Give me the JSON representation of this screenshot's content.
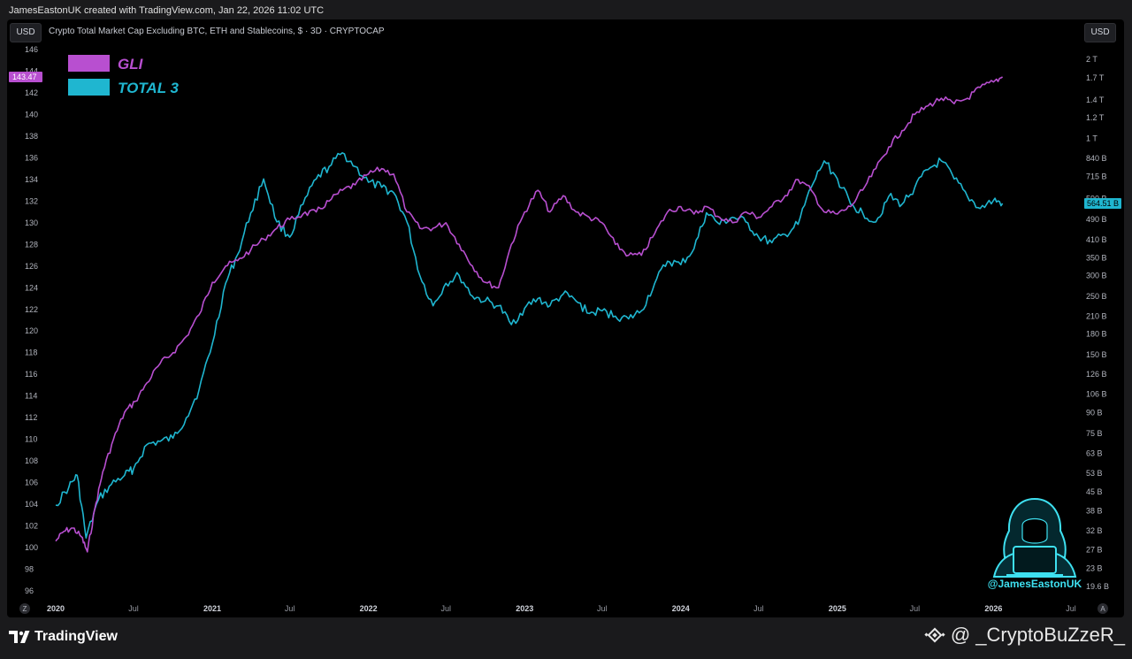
{
  "header": {
    "caption": "JamesEastonUK created with TradingView.com, Jan 22, 2026 11:02 UTC"
  },
  "toolbar": {
    "currency_left": "USD",
    "currency_right": "USD"
  },
  "symbol": {
    "title": "Crypto Total Market Cap Excluding BTC, ETH and Stablecoins, $ · 3D · CRYPTOCAP"
  },
  "footer": {
    "brand": "TradingView",
    "watermark": "@ _CryptoBuZzeR_",
    "handle": "@JamesEastonUK"
  },
  "buttons": {
    "z": "Z",
    "a": "A"
  },
  "colors": {
    "gli": "#b84fd0",
    "total3": "#1fb6d0",
    "background": "#000000"
  },
  "chart_data": {
    "type": "line",
    "legend": [
      {
        "name": "GLI",
        "color": "#b84fd0"
      },
      {
        "name": "TOTAL 3",
        "color": "#1fb6d0"
      }
    ],
    "legend_position": "top-left",
    "grid": false,
    "x_ticks": [
      "2020",
      "Jul",
      "2021",
      "Jul",
      "2022",
      "Jul",
      "2023",
      "Jul",
      "2024",
      "Jul",
      "2025",
      "Jul",
      "2026",
      "Jul"
    ],
    "x_range": [
      "2020-01",
      "2026-07"
    ],
    "y_left": {
      "ticks": [
        96,
        98,
        100,
        102,
        104,
        106,
        108,
        110,
        112,
        114,
        116,
        118,
        120,
        122,
        124,
        126,
        128,
        130,
        132,
        134,
        136,
        138,
        140,
        142,
        144,
        146
      ],
      "ylim": [
        96,
        146
      ],
      "last_value_label": "143.47"
    },
    "y_right": {
      "scale": "log",
      "ticks": [
        {
          "label": "19.6 B",
          "v": 19.6
        },
        {
          "label": "23 B",
          "v": 23
        },
        {
          "label": "27 B",
          "v": 27
        },
        {
          "label": "32 B",
          "v": 32
        },
        {
          "label": "38 B",
          "v": 38
        },
        {
          "label": "45 B",
          "v": 45
        },
        {
          "label": "53 B",
          "v": 53
        },
        {
          "label": "63 B",
          "v": 63
        },
        {
          "label": "75 B",
          "v": 75
        },
        {
          "label": "90 B",
          "v": 90
        },
        {
          "label": "106 B",
          "v": 106
        },
        {
          "label": "126 B",
          "v": 126
        },
        {
          "label": "150 B",
          "v": 150
        },
        {
          "label": "180 B",
          "v": 180
        },
        {
          "label": "210 B",
          "v": 210
        },
        {
          "label": "250 B",
          "v": 250
        },
        {
          "label": "300 B",
          "v": 300
        },
        {
          "label": "350 B",
          "v": 350
        },
        {
          "label": "410 B",
          "v": 410
        },
        {
          "label": "490 B",
          "v": 490
        },
        {
          "label": "590 B",
          "v": 590
        },
        {
          "label": "715 B",
          "v": 715
        },
        {
          "label": "840 B",
          "v": 840
        },
        {
          "label": "1 T",
          "v": 1000
        },
        {
          "label": "1.2 T",
          "v": 1200
        },
        {
          "label": "1.4 T",
          "v": 1400
        },
        {
          "label": "1.7 T",
          "v": 1700
        },
        {
          "label": "2 T",
          "v": 2000
        }
      ],
      "last_value_label": "564.51 B"
    },
    "series": [
      {
        "name": "GLI",
        "axis": "left",
        "points": [
          [
            "2020-01-01",
            100.6
          ],
          [
            "2020-01-20",
            101.5
          ],
          [
            "2020-02-10",
            101.8
          ],
          [
            "2020-03-01",
            101.0
          ],
          [
            "2020-03-15",
            99.6
          ],
          [
            "2020-04-01",
            103.5
          ],
          [
            "2020-04-20",
            107.0
          ],
          [
            "2020-05-15",
            110.0
          ],
          [
            "2020-06-10",
            112.5
          ],
          [
            "2020-07-05",
            113.5
          ],
          [
            "2020-08-01",
            115.2
          ],
          [
            "2020-09-01",
            117.0
          ],
          [
            "2020-10-01",
            118.0
          ],
          [
            "2020-11-01",
            119.5
          ],
          [
            "2020-12-01",
            121.5
          ],
          [
            "2021-01-01",
            124.5
          ],
          [
            "2021-02-01",
            126.0
          ],
          [
            "2021-03-01",
            126.5
          ],
          [
            "2021-04-01",
            127.5
          ],
          [
            "2021-05-01",
            128.5
          ],
          [
            "2021-06-01",
            129.5
          ],
          [
            "2021-07-01",
            130.3
          ],
          [
            "2021-08-01",
            130.8
          ],
          [
            "2021-09-01",
            131.0
          ],
          [
            "2021-10-01",
            132.0
          ],
          [
            "2021-11-01",
            133.0
          ],
          [
            "2021-12-01",
            133.5
          ],
          [
            "2022-01-01",
            134.5
          ],
          [
            "2022-02-01",
            135.0
          ],
          [
            "2022-03-01",
            134.5
          ],
          [
            "2022-04-01",
            131.0
          ],
          [
            "2022-05-01",
            129.5
          ],
          [
            "2022-06-01",
            129.5
          ],
          [
            "2022-07-01",
            130.0
          ],
          [
            "2022-08-01",
            128.0
          ],
          [
            "2022-09-01",
            126.0
          ],
          [
            "2022-10-01",
            124.5
          ],
          [
            "2022-11-01",
            124.0
          ],
          [
            "2022-12-01",
            128.0
          ],
          [
            "2023-01-01",
            131.0
          ],
          [
            "2023-02-01",
            133.0
          ],
          [
            "2023-03-01",
            131.0
          ],
          [
            "2023-04-01",
            132.5
          ],
          [
            "2023-05-01",
            131.0
          ],
          [
            "2023-06-01",
            130.5
          ],
          [
            "2023-07-01",
            130.0
          ],
          [
            "2023-08-01",
            128.0
          ],
          [
            "2023-09-01",
            127.0
          ],
          [
            "2023-10-01",
            127.0
          ],
          [
            "2023-11-01",
            129.0
          ],
          [
            "2023-12-01",
            131.0
          ],
          [
            "2024-01-01",
            131.5
          ],
          [
            "2024-02-01",
            130.8
          ],
          [
            "2024-03-01",
            131.5
          ],
          [
            "2024-04-01",
            130.5
          ],
          [
            "2024-05-01",
            130.0
          ],
          [
            "2024-06-01",
            131.0
          ],
          [
            "2024-07-01",
            130.5
          ],
          [
            "2024-08-01",
            131.5
          ],
          [
            "2024-09-01",
            132.5
          ],
          [
            "2024-10-01",
            134.0
          ],
          [
            "2024-11-01",
            133.0
          ],
          [
            "2024-12-01",
            131.0
          ],
          [
            "2025-01-01",
            130.8
          ],
          [
            "2025-02-01",
            131.5
          ],
          [
            "2025-03-01",
            133.0
          ],
          [
            "2025-04-01",
            135.0
          ],
          [
            "2025-05-01",
            137.0
          ],
          [
            "2025-06-01",
            138.5
          ],
          [
            "2025-07-01",
            140.0
          ],
          [
            "2025-08-01",
            140.8
          ],
          [
            "2025-09-01",
            141.5
          ],
          [
            "2025-10-01",
            141.0
          ],
          [
            "2025-11-01",
            141.5
          ],
          [
            "2025-12-01",
            142.5
          ],
          [
            "2026-01-01",
            143.0
          ],
          [
            "2026-01-22",
            143.47
          ]
        ]
      },
      {
        "name": "TOTAL 3",
        "axis": "right",
        "points": [
          [
            "2020-01-01",
            40
          ],
          [
            "2020-02-01",
            47
          ],
          [
            "2020-02-20",
            52
          ],
          [
            "2020-03-12",
            30
          ],
          [
            "2020-04-10",
            42
          ],
          [
            "2020-05-10",
            48
          ],
          [
            "2020-06-10",
            52
          ],
          [
            "2020-07-01",
            55
          ],
          [
            "2020-08-01",
            68
          ],
          [
            "2020-09-01",
            70
          ],
          [
            "2020-10-01",
            72
          ],
          [
            "2020-11-01",
            86
          ],
          [
            "2020-12-01",
            110
          ],
          [
            "2021-01-01",
            165
          ],
          [
            "2021-02-01",
            280
          ],
          [
            "2021-03-01",
            360
          ],
          [
            "2021-04-01",
            520
          ],
          [
            "2021-05-01",
            700
          ],
          [
            "2021-06-01",
            480
          ],
          [
            "2021-07-01",
            420
          ],
          [
            "2021-08-01",
            560
          ],
          [
            "2021-09-01",
            700
          ],
          [
            "2021-10-01",
            780
          ],
          [
            "2021-11-01",
            880
          ],
          [
            "2021-12-01",
            780
          ],
          [
            "2022-01-01",
            680
          ],
          [
            "2022-02-01",
            650
          ],
          [
            "2022-03-01",
            620
          ],
          [
            "2022-04-01",
            480
          ],
          [
            "2022-05-01",
            300
          ],
          [
            "2022-06-01",
            230
          ],
          [
            "2022-07-01",
            280
          ],
          [
            "2022-08-01",
            300
          ],
          [
            "2022-09-01",
            250
          ],
          [
            "2022-10-01",
            240
          ],
          [
            "2022-11-01",
            230
          ],
          [
            "2022-12-01",
            195
          ],
          [
            "2023-01-01",
            225
          ],
          [
            "2023-02-01",
            245
          ],
          [
            "2023-03-01",
            230
          ],
          [
            "2023-04-01",
            255
          ],
          [
            "2023-05-01",
            240
          ],
          [
            "2023-06-01",
            215
          ],
          [
            "2023-07-01",
            220
          ],
          [
            "2023-08-01",
            210
          ],
          [
            "2023-09-01",
            205
          ],
          [
            "2023-10-01",
            220
          ],
          [
            "2023-11-01",
            280
          ],
          [
            "2023-12-01",
            340
          ],
          [
            "2024-01-01",
            330
          ],
          [
            "2024-02-01",
            380
          ],
          [
            "2024-03-01",
            520
          ],
          [
            "2024-04-01",
            470
          ],
          [
            "2024-05-01",
            500
          ],
          [
            "2024-06-01",
            480
          ],
          [
            "2024-07-01",
            420
          ],
          [
            "2024-08-01",
            400
          ],
          [
            "2024-09-01",
            430
          ],
          [
            "2024-10-01",
            470
          ],
          [
            "2024-11-01",
            650
          ],
          [
            "2024-12-01",
            820
          ],
          [
            "2025-01-01",
            700
          ],
          [
            "2025-02-01",
            560
          ],
          [
            "2025-03-01",
            520
          ],
          [
            "2025-04-01",
            480
          ],
          [
            "2025-05-01",
            600
          ],
          [
            "2025-06-01",
            560
          ],
          [
            "2025-07-01",
            650
          ],
          [
            "2025-08-01",
            760
          ],
          [
            "2025-09-01",
            820
          ],
          [
            "2025-10-01",
            700
          ],
          [
            "2025-11-01",
            600
          ],
          [
            "2025-12-01",
            540
          ],
          [
            "2026-01-01",
            580
          ],
          [
            "2026-01-22",
            564.51
          ]
        ]
      }
    ]
  }
}
